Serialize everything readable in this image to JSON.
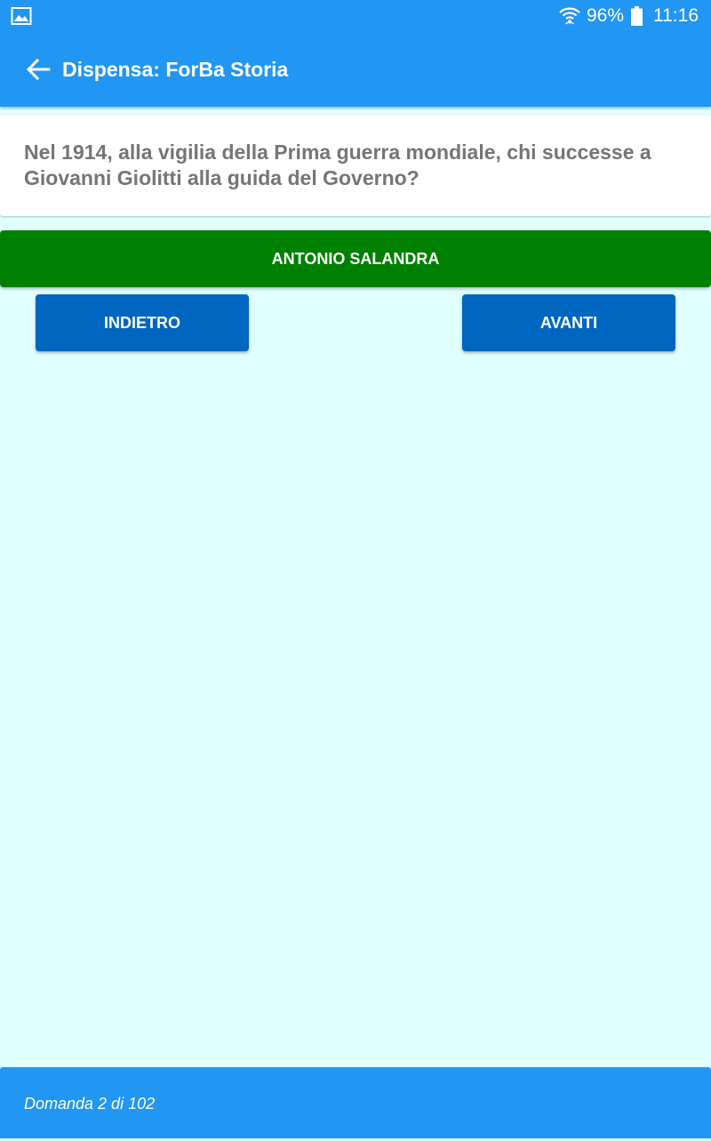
{
  "status_bar": {
    "left_icon": "image-icon",
    "wifi_icon": "wifi-icon",
    "battery_percent": "96%",
    "battery_icon": "battery-icon",
    "time": "11:16"
  },
  "app_bar": {
    "back_icon": "arrow-back-icon",
    "title": "Dispensa: ForBa Storia"
  },
  "question": {
    "text": "Nel 1914, alla vigilia della Prima guerra mondiale, chi successe a Giovanni Giolitti alla guida del Governo?"
  },
  "answer": {
    "text": "ANTONIO SALANDRA"
  },
  "navigation": {
    "back_label": "INDIETRO",
    "next_label": "AVANTI"
  },
  "footer": {
    "progress_text": "Domanda 2 di 102"
  },
  "colors": {
    "primary": "#2196f3",
    "background": "#e0ffff",
    "answer_correct": "#008000",
    "button": "#0066c0",
    "question_text": "#757575"
  }
}
